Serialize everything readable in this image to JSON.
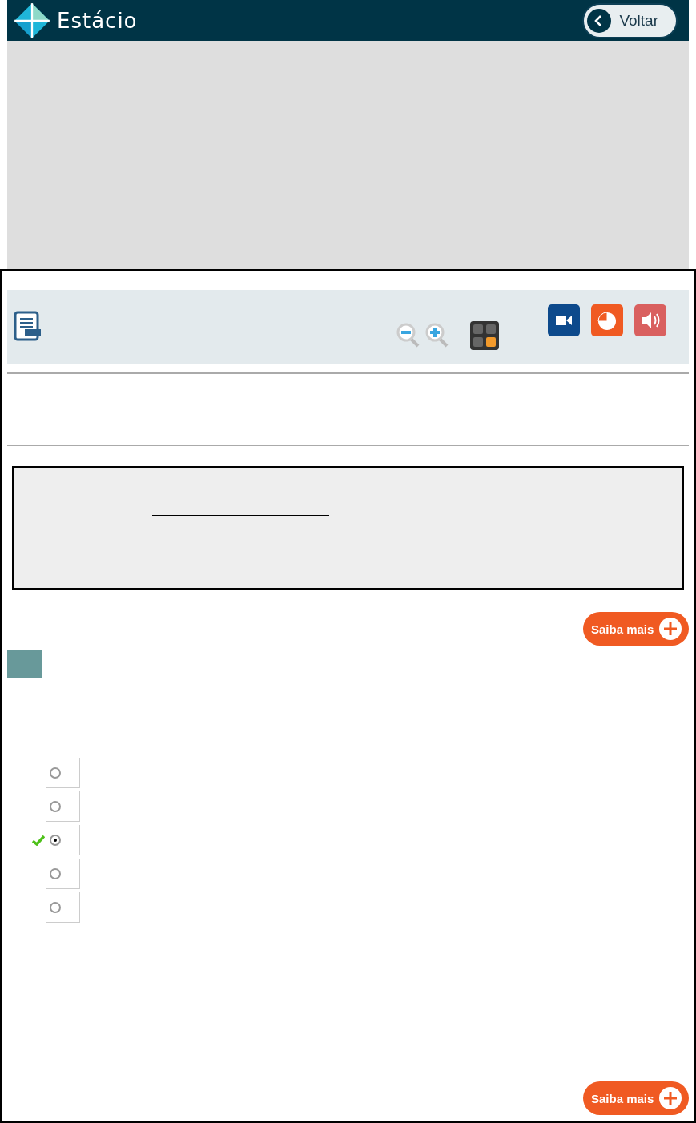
{
  "header": {
    "brand": "Estácio",
    "back_button": "Voltar"
  },
  "buttons": [
    "Saiba mais",
    "Saiba mais"
  ],
  "options": [
    {
      "selected": false,
      "correct": false
    },
    {
      "selected": false,
      "correct": false
    },
    {
      "selected": true,
      "correct": true
    },
    {
      "selected": false,
      "correct": false
    },
    {
      "selected": false,
      "correct": false
    }
  ]
}
